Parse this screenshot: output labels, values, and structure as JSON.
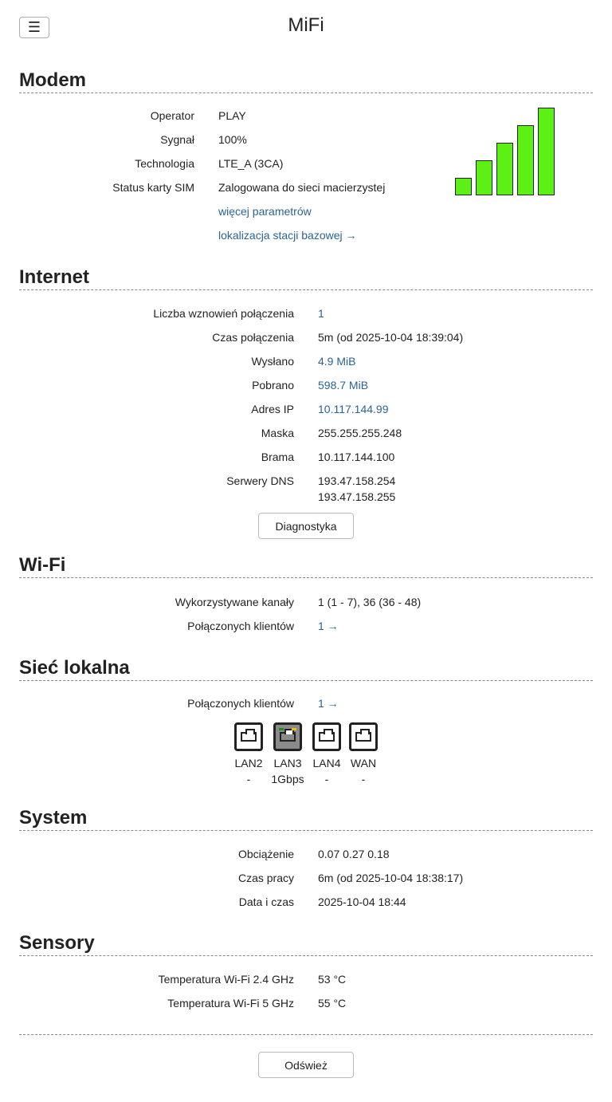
{
  "app": {
    "title": "MiFi",
    "menu_icon": "☰"
  },
  "modem": {
    "title": "Modem",
    "rows": [
      {
        "label": "Operator",
        "value": "PLAY"
      },
      {
        "label": "Sygnał",
        "value": "100%"
      },
      {
        "label": "Technologia",
        "value": "LTE_A (3CA)"
      },
      {
        "label": "Status karty SIM",
        "value": "Zalogowana do sieci macierzystej"
      }
    ],
    "more_params_link": "więcej parametrów",
    "bts_location_link": "lokalizacja stacji bazowej →",
    "signal": {
      "percent": 100,
      "bars_active": 5,
      "bars_total": 5,
      "bar_color": "#5cf014"
    }
  },
  "internet": {
    "title": "Internet",
    "rows": [
      {
        "label": "Liczba wznowień połączenia",
        "value": "1"
      },
      {
        "label": "Czas połączenia",
        "value": "5m (od 2025-10-04 18:39:04)"
      },
      {
        "label": "Wysłano",
        "value": "4.9 MiB"
      },
      {
        "label": "Pobrano",
        "value": "598.7 MiB"
      },
      {
        "label": "Adres IP",
        "value": "10.117.144.99"
      },
      {
        "label": "Maska",
        "value": "255.255.255.248"
      },
      {
        "label": "Brama",
        "value": "10.117.144.100"
      },
      {
        "label": "Serwery DNS",
        "value": "193.47.158.254",
        "value2": "193.47.158.255"
      }
    ],
    "diagnostics_button": "Diagnostyka"
  },
  "wifi": {
    "title": "Wi-Fi",
    "rows": [
      {
        "label": "Wykorzystywane kanały",
        "value": "1 (1 - 7), 36 (36 - 48)"
      },
      {
        "label": "Połączonych klientów",
        "value": "1 →"
      }
    ]
  },
  "lan": {
    "title": "Sieć lokalna",
    "rows": [
      {
        "label": "Połączonych klientów",
        "value": "1 →"
      }
    ],
    "ports": [
      {
        "name": "LAN2",
        "speed": "-",
        "active": false
      },
      {
        "name": "LAN3",
        "speed": "1Gbps",
        "active": true
      },
      {
        "name": "LAN4",
        "speed": "-",
        "active": false
      },
      {
        "name": "WAN",
        "speed": "-",
        "active": false
      }
    ]
  },
  "system": {
    "title": "System",
    "rows": [
      {
        "label": "Obciążenie",
        "value": "0.07 0.27 0.18"
      },
      {
        "label": "Czas pracy",
        "value": "6m (od 2025-10-04 18:38:17)"
      },
      {
        "label": "Data i czas",
        "value": "2025-10-04 18:44"
      }
    ]
  },
  "sensors": {
    "title": "Sensory",
    "rows": [
      {
        "label": "Temperatura Wi-Fi 2.4 GHz",
        "value": "53 °C"
      },
      {
        "label": "Temperatura Wi-Fi 5 GHz",
        "value": "55 °C"
      }
    ]
  },
  "footer": {
    "refresh_button": "Odśwież"
  }
}
